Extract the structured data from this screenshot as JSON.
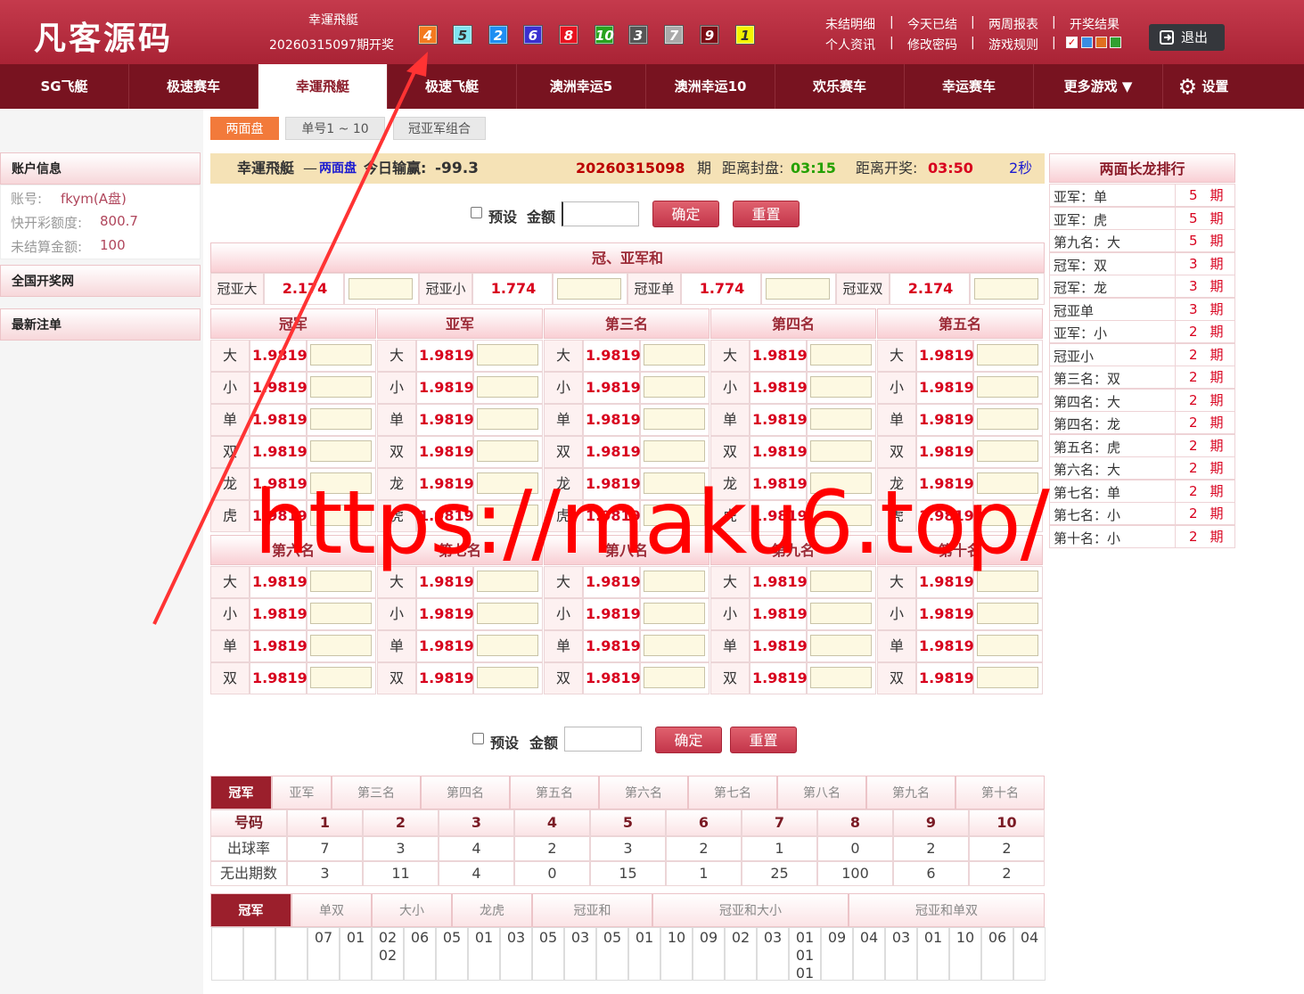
{
  "header": {
    "logo": "凡客源码",
    "game": "幸運飛艇",
    "period": "20260315097期开奖",
    "balls": [
      {
        "n": "4",
        "c": "#f47a1f"
      },
      {
        "n": "5",
        "c": "#7fe3f0"
      },
      {
        "n": "2",
        "c": "#1e8ef2"
      },
      {
        "n": "6",
        "c": "#3a2fcf"
      },
      {
        "n": "8",
        "c": "#e8121f"
      },
      {
        "n": "10",
        "c": "#29a31f"
      },
      {
        "n": "3",
        "c": "#555555"
      },
      {
        "n": "7",
        "c": "#aaaaaa"
      },
      {
        "n": "9",
        "c": "#7a0c14"
      },
      {
        "n": "1",
        "c": "#f4f400"
      }
    ],
    "links_row1": [
      "未结明细",
      "今天已结",
      "两周报表",
      "开奖结果"
    ],
    "links_row2": [
      "个人资讯",
      "修改密码",
      "游戏规则"
    ],
    "colors": [
      "#3a8de3",
      "#e07020",
      "#30a030"
    ],
    "logout": "退出"
  },
  "nav": [
    "SG飞艇",
    "极速赛车",
    "幸運飛艇",
    "极速飞艇",
    "澳洲幸运5",
    "澳洲幸运10",
    "欢乐赛车",
    "幸运赛车",
    "更多游戏 ▼"
  ],
  "settings": "设置",
  "subtabs": [
    "两面盘",
    "单号1 ~ 10",
    "冠亚军组合"
  ],
  "sidebar": {
    "account_title": "账户信息",
    "rows": [
      {
        "k": "账号:",
        "v": "fkym(A盘)"
      },
      {
        "k": "快开彩额度:",
        "v": "800.7"
      },
      {
        "k": "未结算金额:",
        "v": "100"
      }
    ],
    "lottery": "全国开奖网",
    "orders": "最新注单"
  },
  "info": {
    "game": "幸運飛艇",
    "dash": "—",
    "mode": "两面盘",
    "today_label": "今日输赢:",
    "today": "-99.3",
    "period": "20260315098",
    "period_suffix": "期",
    "close_label": "距离封盘:",
    "close": "03:15",
    "draw_label": "距离开奖:",
    "draw": "03:50",
    "refresh": "2秒"
  },
  "form": {
    "preset": "预设",
    "amount": "金额",
    "confirm": "确定",
    "reset": "重置"
  },
  "sum": {
    "title": "冠、亚军和",
    "items": [
      {
        "k": "冠亚大",
        "v": "2.174"
      },
      {
        "k": "冠亚小",
        "v": "1.774"
      },
      {
        "k": "冠亚单",
        "v": "1.774"
      },
      {
        "k": "冠亚双",
        "v": "2.174"
      }
    ]
  },
  "ranks_top": [
    "冠军",
    "亚军",
    "第三名",
    "第四名",
    "第五名"
  ],
  "ranks_bottom": [
    "第六名",
    "第七名",
    "第八名",
    "第九名",
    "第十名"
  ],
  "opts_top": [
    "大",
    "小",
    "单",
    "双",
    "龙",
    "虎"
  ],
  "opts_bottom": [
    "大",
    "小",
    "单",
    "双"
  ],
  "odds": "1.9819",
  "long": {
    "title": "两面长龙排行",
    "rows": [
      {
        "k": "亚军：单",
        "v": "5"
      },
      {
        "k": "亚军：虎",
        "v": "5"
      },
      {
        "k": "第九名：大",
        "v": "5"
      },
      {
        "k": "冠军：双",
        "v": "3"
      },
      {
        "k": "冠军：龙",
        "v": "3"
      },
      {
        "k": "冠亚单",
        "v": "3"
      },
      {
        "k": "亚军：小",
        "v": "2"
      },
      {
        "k": "冠亚小",
        "v": "2"
      },
      {
        "k": "第三名：双",
        "v": "2"
      },
      {
        "k": "第四名：大",
        "v": "2"
      },
      {
        "k": "第四名：龙",
        "v": "2"
      },
      {
        "k": "第五名：虎",
        "v": "2"
      },
      {
        "k": "第六名：大",
        "v": "2"
      },
      {
        "k": "第七名：单",
        "v": "2"
      },
      {
        "k": "第七名：小",
        "v": "2"
      },
      {
        "k": "第十名：小",
        "v": "2"
      }
    ],
    "unit": "期"
  },
  "stats": {
    "tabs": [
      "冠军",
      "亚军",
      "第三名",
      "第四名",
      "第五名",
      "第六名",
      "第七名",
      "第八名",
      "第九名",
      "第十名"
    ],
    "head": [
      "号码",
      "1",
      "2",
      "3",
      "4",
      "5",
      "6",
      "7",
      "8",
      "9",
      "10"
    ],
    "rows": [
      [
        "出球率",
        "7",
        "3",
        "4",
        "2",
        "3",
        "2",
        "1",
        "0",
        "2",
        "2"
      ],
      [
        "无出期数",
        "3",
        "11",
        "4",
        "0",
        "15",
        "1",
        "25",
        "100",
        "6",
        "2"
      ]
    ]
  },
  "road": {
    "tabs": [
      "冠军",
      "单双",
      "大小",
      "龙虎",
      "冠亚和",
      "冠亚和大小",
      "冠亚和单双"
    ],
    "cols": [
      [],
      [],
      [],
      [
        "07"
      ],
      [
        "01"
      ],
      [
        "02",
        "02"
      ],
      [
        "06"
      ],
      [
        "05"
      ],
      [
        "01"
      ],
      [
        "03"
      ],
      [
        "05"
      ],
      [
        "03"
      ],
      [
        "05"
      ],
      [
        "01"
      ],
      [
        "10"
      ],
      [
        "09"
      ],
      [
        "02"
      ],
      [
        "03"
      ],
      [
        "01",
        "01",
        "01"
      ],
      [
        "09"
      ],
      [
        "04"
      ],
      [
        "03"
      ],
      [
        "01"
      ],
      [
        "10"
      ],
      [
        "06"
      ],
      [
        "04"
      ]
    ]
  },
  "watermark": "https://maku6.top/"
}
